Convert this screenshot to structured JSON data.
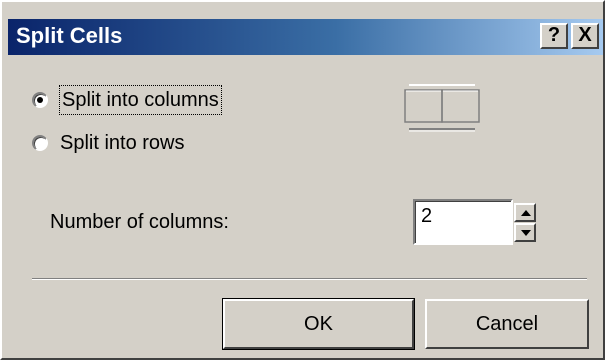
{
  "window": {
    "title": "Split Cells",
    "help_label": "?",
    "close_label": "X"
  },
  "options": {
    "columns_label": "Split into columns",
    "rows_label": "Split into rows",
    "selected": "columns"
  },
  "number": {
    "label": "Number of columns:",
    "value": "2"
  },
  "buttons": {
    "ok_label": "OK",
    "cancel_label": "Cancel"
  },
  "icons": {
    "preview": "split-columns-preview-icon",
    "spin_up": "up-arrow-icon",
    "spin_down": "down-arrow-icon"
  },
  "colors": {
    "titlebar_start": "#0a246a",
    "titlebar_end": "#a6caf0",
    "face": "#d4d0c8"
  }
}
